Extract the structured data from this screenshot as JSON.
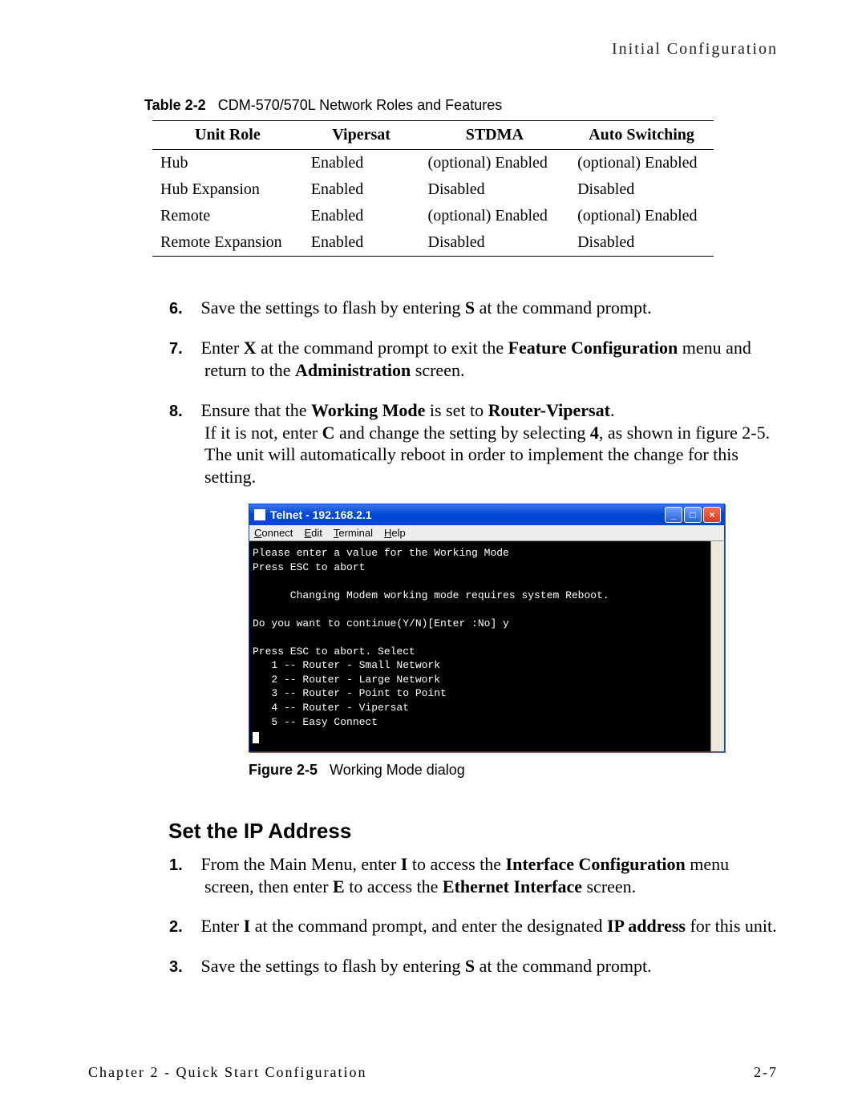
{
  "header": {
    "title": "Initial Configuration"
  },
  "table": {
    "caption_label": "Table 2-2",
    "caption_text": "CDM-570/570L Network Roles and Features",
    "headers": [
      "Unit Role",
      "Vipersat",
      "STDMA",
      "Auto Switching"
    ],
    "rows": [
      [
        "Hub",
        "Enabled",
        "(optional) Enabled",
        "(optional) Enabled"
      ],
      [
        "Hub Expansion",
        "Enabled",
        "Disabled",
        "Disabled"
      ],
      [
        "Remote",
        "Enabled",
        "(optional) Enabled",
        "(optional) Enabled"
      ],
      [
        "Remote Expansion",
        "Enabled",
        "Disabled",
        "Disabled"
      ]
    ]
  },
  "steps_a": {
    "6": {
      "parts": [
        {
          "t": "Save the settings to flash by entering "
        },
        {
          "t": "S",
          "b": true
        },
        {
          "t": " at the command prompt."
        }
      ]
    },
    "7": {
      "parts": [
        {
          "t": "Enter "
        },
        {
          "t": "X",
          "b": true
        },
        {
          "t": " at the command prompt to exit the "
        },
        {
          "t": "Feature Configuration",
          "b": true
        },
        {
          "t": " menu and return to the "
        },
        {
          "t": "Administration",
          "b": true
        },
        {
          "t": " screen."
        }
      ]
    },
    "8": {
      "parts": [
        {
          "t": "Ensure that the "
        },
        {
          "t": "Working Mode",
          "b": true
        },
        {
          "t": " is set to "
        },
        {
          "t": "Router-Vipersat",
          "b": true
        },
        {
          "t": ".\nIf it is not, enter "
        },
        {
          "t": "C",
          "b": true
        },
        {
          "t": " and change the setting by selecting "
        },
        {
          "t": "4",
          "b": true
        },
        {
          "t": ", as shown in figure 2-5. The unit will automatically reboot in order to implement the change for this setting."
        }
      ]
    }
  },
  "telnet": {
    "title": "Telnet - 192.168.2.1",
    "menu": [
      "Connect",
      "Edit",
      "Terminal",
      "Help"
    ],
    "lines": "Please enter a value for the Working Mode\nPress ESC to abort\n\n      Changing Modem working mode requires system Reboot.\n\nDo you want to continue(Y/N)[Enter :No] y\n\nPress ESC to abort. Select\n   1 -- Router - Small Network\n   2 -- Router - Large Network\n   3 -- Router - Point to Point\n   4 -- Router - Vipersat\n   5 -- Easy Connect"
  },
  "figure": {
    "label": "Figure 2-5",
    "text": "Working Mode dialog"
  },
  "section": {
    "title": "Set the IP Address"
  },
  "steps_b": {
    "1": {
      "parts": [
        {
          "t": "From the Main Menu, enter "
        },
        {
          "t": "I",
          "b": true
        },
        {
          "t": " to access the "
        },
        {
          "t": "Interface Configuration",
          "b": true
        },
        {
          "t": " menu screen, then enter "
        },
        {
          "t": "E",
          "b": true
        },
        {
          "t": " to access the "
        },
        {
          "t": "Ethernet Interface",
          "b": true
        },
        {
          "t": " screen."
        }
      ]
    },
    "2": {
      "parts": [
        {
          "t": "Enter "
        },
        {
          "t": "I",
          "b": true
        },
        {
          "t": " at the command prompt, and enter the designated "
        },
        {
          "t": "IP address",
          "b": true
        },
        {
          "t": " for this unit."
        }
      ]
    },
    "3": {
      "parts": [
        {
          "t": "Save the settings to flash by entering "
        },
        {
          "t": "S",
          "b": true
        },
        {
          "t": " at the command prompt."
        }
      ]
    }
  },
  "footer": {
    "left": "Chapter 2 - Quick Start Configuration",
    "right": "2-7"
  }
}
